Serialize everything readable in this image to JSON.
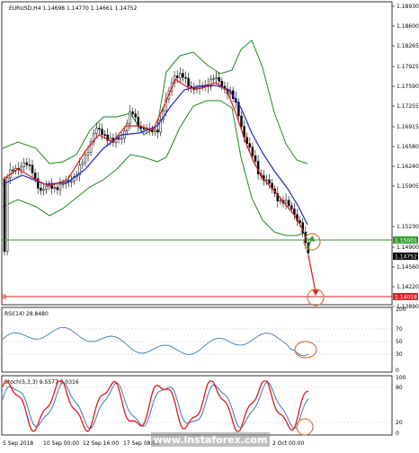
{
  "main": {
    "symbol_info": "EURUSD,H4  1.14698 1.14770 1.14661 1.14752",
    "price_labels": [
      "1.18930",
      "1.18600",
      "1.18265",
      "1.17925",
      "1.17590",
      "1.17255",
      "1.16915",
      "1.16580",
      "1.16240",
      "1.15905",
      "1.15230",
      "1.14900",
      "1.14560",
      "1.14220",
      "1.13890"
    ],
    "highlight_tags": {
      "green": {
        "value": "1.15001",
        "color": "#2e9e2e"
      },
      "dark": {
        "value": "1.14752",
        "color": "#000000"
      },
      "red": {
        "value": "1.14018",
        "color": "#e02020"
      }
    }
  },
  "rsi": {
    "label": "RSI(14) 28.8480",
    "levels": [
      "100",
      "70",
      "50",
      "30",
      "0"
    ]
  },
  "stoch": {
    "label": "Stoch(5,3,3) 9.5577 9.0316",
    "levels": [
      "100",
      "80",
      "20",
      "0"
    ]
  },
  "time_axis": [
    "5 Sep 2018",
    "10 Sep 00:00",
    "12 Sep 16:00",
    "17 Sep 08:00",
    "2 Oct 00:00"
  ],
  "watermark": "www.instaforex.com",
  "colors": {
    "bull_candle": "#ffffff",
    "bear_candle": "#000000",
    "ma_fast": "#e01818",
    "ma_slow": "#1c23d8",
    "bollinger": "#1e8a1e",
    "rsi_line": "#3b78b8",
    "stoch_main": "#e01818",
    "stoch_signal": "#3b78b8",
    "support_line": "#2e9e2e",
    "target_line": "#e02020",
    "circle": "#d07a40"
  }
}
